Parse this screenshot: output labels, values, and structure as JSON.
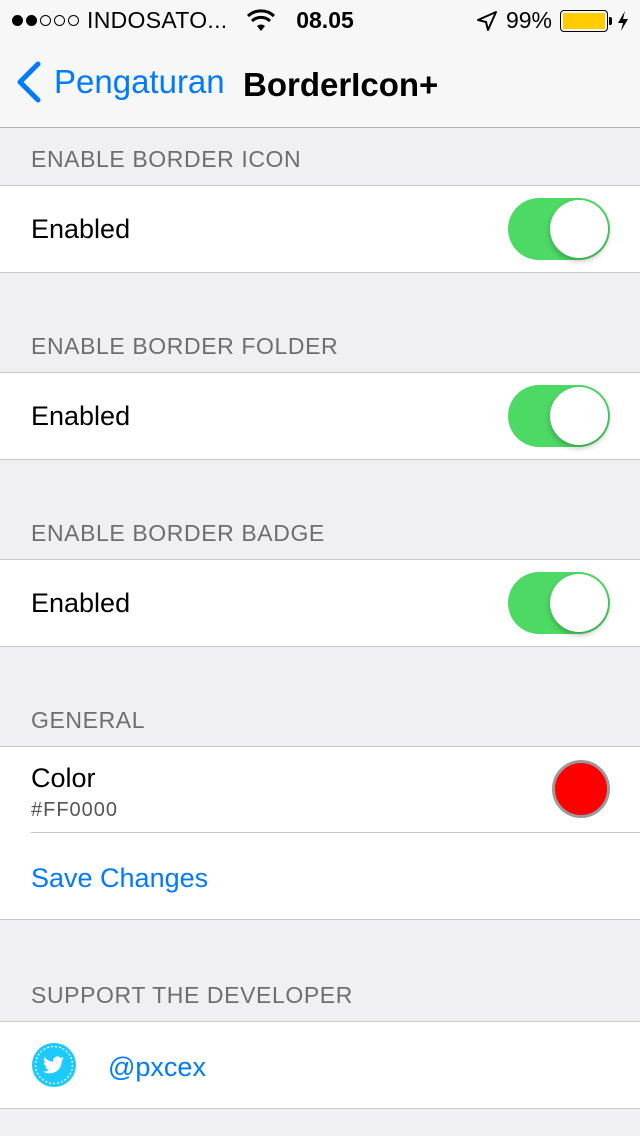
{
  "status_bar": {
    "carrier": "INDOSATO...",
    "time": "08.05",
    "battery_text": "99%",
    "battery_level": 0.99,
    "battery_color": "#ffcc00",
    "signal_bars_filled": 2,
    "signal_bars_total": 5
  },
  "nav": {
    "back_label": "Pengaturan",
    "title": "BorderIcon+"
  },
  "sections": {
    "icon": {
      "header": "ENABLE BORDER ICON",
      "row_label": "Enabled",
      "enabled": true
    },
    "folder": {
      "header": "ENABLE BORDER FOLDER",
      "row_label": "Enabled",
      "enabled": true
    },
    "badge": {
      "header": "ENABLE BORDER BADGE",
      "row_label": "Enabled",
      "enabled": true
    },
    "general": {
      "header": "GENERAL",
      "color_label": "Color",
      "color_value": "#FF0000",
      "save_label": "Save Changes"
    },
    "support": {
      "header": "SUPPORT THE DEVELOPER",
      "twitter_handle": "@pxcex"
    }
  },
  "colors": {
    "accent": "#007aff",
    "toggle_on": "#4cd964",
    "background": "#efeff4",
    "twitter": "#1dcaff"
  }
}
